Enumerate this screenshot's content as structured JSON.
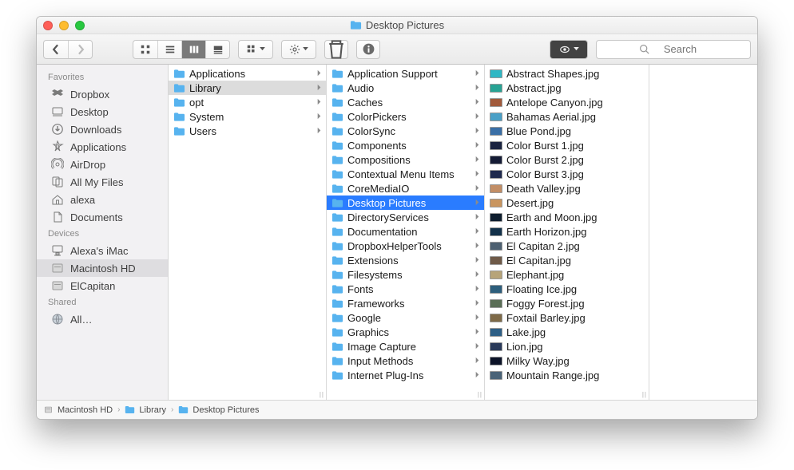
{
  "window_title": "Desktop Pictures",
  "search_placeholder": "Search",
  "sidebar": {
    "sections": [
      {
        "header": "Favorites",
        "items": [
          {
            "label": "Dropbox",
            "icon": "dropbox"
          },
          {
            "label": "Desktop",
            "icon": "desktop"
          },
          {
            "label": "Downloads",
            "icon": "downloads"
          },
          {
            "label": "Applications",
            "icon": "apps"
          },
          {
            "label": "AirDrop",
            "icon": "airdrop"
          },
          {
            "label": "All My Files",
            "icon": "allfiles"
          },
          {
            "label": "alexa",
            "icon": "home"
          },
          {
            "label": "Documents",
            "icon": "documents"
          }
        ]
      },
      {
        "header": "Devices",
        "items": [
          {
            "label": "Alexa's iMac",
            "icon": "imac"
          },
          {
            "label": "Macintosh HD",
            "icon": "hdd",
            "selected": true
          },
          {
            "label": "ElCapitan",
            "icon": "hdd"
          }
        ]
      },
      {
        "header": "Shared",
        "items": [
          {
            "label": "All…",
            "icon": "globe"
          }
        ]
      }
    ]
  },
  "columns": [
    {
      "items": [
        {
          "label": "Applications",
          "folder": true,
          "chev": true
        },
        {
          "label": "Library",
          "folder": true,
          "chev": true,
          "sel": "gray"
        },
        {
          "label": "opt",
          "folder": true,
          "chev": true
        },
        {
          "label": "System",
          "folder": true,
          "chev": true
        },
        {
          "label": "Users",
          "folder": true,
          "chev": true
        }
      ]
    },
    {
      "items": [
        {
          "label": "Application Support",
          "folder": true,
          "chev": true
        },
        {
          "label": "Audio",
          "folder": true,
          "chev": true
        },
        {
          "label": "Caches",
          "folder": true,
          "chev": true
        },
        {
          "label": "ColorPickers",
          "folder": true,
          "chev": true
        },
        {
          "label": "ColorSync",
          "folder": true,
          "chev": true
        },
        {
          "label": "Components",
          "folder": true,
          "chev": true
        },
        {
          "label": "Compositions",
          "folder": true,
          "chev": true
        },
        {
          "label": "Contextual Menu Items",
          "folder": true,
          "chev": true
        },
        {
          "label": "CoreMediaIO",
          "folder": true,
          "chev": true
        },
        {
          "label": "Desktop Pictures",
          "folder": true,
          "chev": true,
          "sel": "blue"
        },
        {
          "label": "DirectoryServices",
          "folder": true,
          "chev": true
        },
        {
          "label": "Documentation",
          "folder": true,
          "chev": true
        },
        {
          "label": "DropboxHelperTools",
          "folder": true,
          "chev": true
        },
        {
          "label": "Extensions",
          "folder": true,
          "chev": true
        },
        {
          "label": "Filesystems",
          "folder": true,
          "chev": true
        },
        {
          "label": "Fonts",
          "folder": true,
          "chev": true
        },
        {
          "label": "Frameworks",
          "folder": true,
          "chev": true
        },
        {
          "label": "Google",
          "folder": true,
          "chev": true
        },
        {
          "label": "Graphics",
          "folder": true,
          "chev": true
        },
        {
          "label": "Image Capture",
          "folder": true,
          "chev": true
        },
        {
          "label": "Input Methods",
          "folder": true,
          "chev": true
        },
        {
          "label": "Internet Plug-Ins",
          "folder": true,
          "chev": true
        }
      ]
    },
    {
      "items": [
        {
          "label": "Abstract Shapes.jpg",
          "thumb": "#2fb7c4"
        },
        {
          "label": "Abstract.jpg",
          "thumb": "#28a394"
        },
        {
          "label": "Antelope Canyon.jpg",
          "thumb": "#a15a3b"
        },
        {
          "label": "Bahamas Aerial.jpg",
          "thumb": "#4aa0c7"
        },
        {
          "label": "Blue Pond.jpg",
          "thumb": "#3a6fa6"
        },
        {
          "label": "Color Burst 1.jpg",
          "thumb": "#1a2340"
        },
        {
          "label": "Color Burst 2.jpg",
          "thumb": "#141b35"
        },
        {
          "label": "Color Burst 3.jpg",
          "thumb": "#1f2a4e"
        },
        {
          "label": "Death Valley.jpg",
          "thumb": "#c28e66"
        },
        {
          "label": "Desert.jpg",
          "thumb": "#c9955f"
        },
        {
          "label": "Earth and Moon.jpg",
          "thumb": "#0e1d2e"
        },
        {
          "label": "Earth Horizon.jpg",
          "thumb": "#12314a"
        },
        {
          "label": "El Capitan 2.jpg",
          "thumb": "#4d6071"
        },
        {
          "label": "El Capitan.jpg",
          "thumb": "#6f5a48"
        },
        {
          "label": "Elephant.jpg",
          "thumb": "#b7a479"
        },
        {
          "label": "Floating Ice.jpg",
          "thumb": "#2d5e7c"
        },
        {
          "label": "Foggy Forest.jpg",
          "thumb": "#5a6e56"
        },
        {
          "label": "Foxtail Barley.jpg",
          "thumb": "#7e6a48"
        },
        {
          "label": "Lake.jpg",
          "thumb": "#2e5f86"
        },
        {
          "label": "Lion.jpg",
          "thumb": "#2a3a5a"
        },
        {
          "label": "Milky Way.jpg",
          "thumb": "#0c1328"
        },
        {
          "label": "Mountain Range.jpg",
          "thumb": "#4a6378"
        }
      ]
    }
  ],
  "pathbar": [
    {
      "label": "Macintosh HD",
      "icon": "hdd"
    },
    {
      "label": "Library",
      "icon": "folder"
    },
    {
      "label": "Desktop Pictures",
      "icon": "folder"
    }
  ]
}
